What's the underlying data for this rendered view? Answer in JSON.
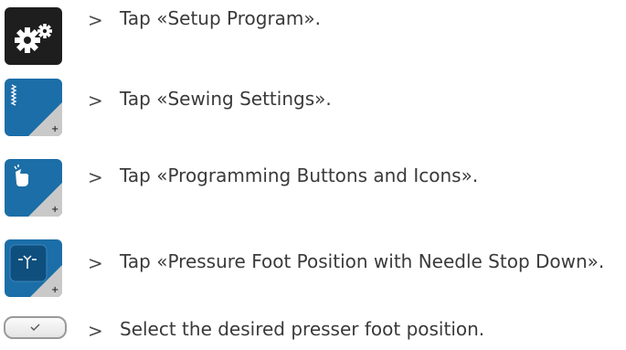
{
  "steps": [
    {
      "icon": "settings-gears-icon",
      "arrow": ">",
      "text": "Tap «Setup Program».",
      "icon_bg": "#1e1e1e"
    },
    {
      "icon": "sewing-settings-icon",
      "arrow": ">",
      "text": "Tap «Sewing Settings».",
      "icon_bg": "#1b6ea7"
    },
    {
      "icon": "programming-buttons-icon",
      "arrow": ">",
      "text": "Tap «Programming Buttons and Icons».",
      "icon_bg": "#1b6ea7"
    },
    {
      "icon": "presser-foot-needle-icon",
      "arrow": ">",
      "text": "Tap «Pressure Foot Position with Needle Stop Down».",
      "icon_bg": "#1b6ea7"
    },
    {
      "icon": "checkmark-toggle-icon",
      "arrow": ">",
      "text": "Select the desired presser foot position.",
      "icon_bg": "#eeeeee"
    }
  ],
  "colors": {
    "accent_blue": "#1b6ea7",
    "dark_button": "#1e1e1e",
    "text": "#3a3a3a"
  }
}
